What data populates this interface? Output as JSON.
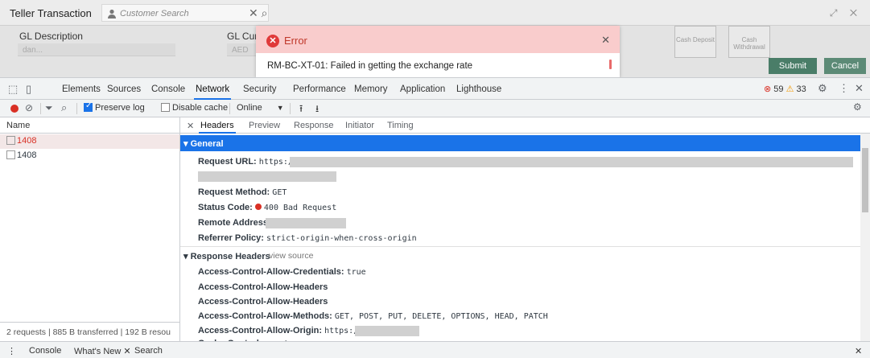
{
  "app": {
    "title": "Teller Transaction",
    "search_placeholder": "Customer Search",
    "gl_description_label": "GL Description",
    "gl_description_value": "dan...",
    "gl_currency_label": "GL Curr",
    "gl_currency_value": "AED",
    "tiles": [
      "Cash Deposit",
      "Cash Withdrawal"
    ],
    "submit_label": "Submit",
    "cancel_label": "Cancel",
    "error": {
      "title": "Error",
      "message": "RM-BC-XT-01: Failed in getting the exchange rate"
    }
  },
  "devtools": {
    "tabs": [
      "Elements",
      "Sources",
      "Console",
      "Network",
      "Security",
      "Performance",
      "Memory",
      "Application",
      "Lighthouse"
    ],
    "active_tab": "Network",
    "error_count": "59",
    "warning_count": "33",
    "toolbar": {
      "preserve_log": "Preserve log",
      "disable_cache": "Disable cache",
      "throttle": "Online"
    },
    "name_header": "Name",
    "requests": [
      "1408",
      "1408"
    ],
    "summary": "2 requests | 885 B transferred | 192 B resou",
    "detail_tabs": [
      "Headers",
      "Preview",
      "Response",
      "Initiator",
      "Timing"
    ],
    "general_label": "▾ General",
    "general": {
      "request_url_key": "Request URL:",
      "request_url_val": "https://",
      "request_method_key": "Request Method:",
      "request_method_val": "GET",
      "status_code_key": "Status Code:",
      "status_code_val": "400 Bad Request",
      "remote_address_key": "Remote Address:",
      "referrer_policy_key": "Referrer Policy:",
      "referrer_policy_val": "strict-origin-when-cross-origin"
    },
    "response_headers_label": "▾ Response Headers",
    "view_source": "view source",
    "response_headers": [
      {
        "key": "Access-Control-Allow-Credentials:",
        "val": "true"
      },
      {
        "key": "Access-Control-Allow-Headers",
        "val": ""
      },
      {
        "key": "Access-Control-Allow-Headers",
        "val": ""
      },
      {
        "key": "Access-Control-Allow-Methods:",
        "val": "GET, POST, PUT, DELETE, OPTIONS, HEAD, PATCH"
      },
      {
        "key": "Access-Control-Allow-Origin:",
        "val": "https://"
      },
      {
        "key": "Cache-Control:",
        "val": "no-store"
      }
    ],
    "drawer": {
      "console": "Console",
      "whats_new": "What's New",
      "search": "Search"
    }
  }
}
